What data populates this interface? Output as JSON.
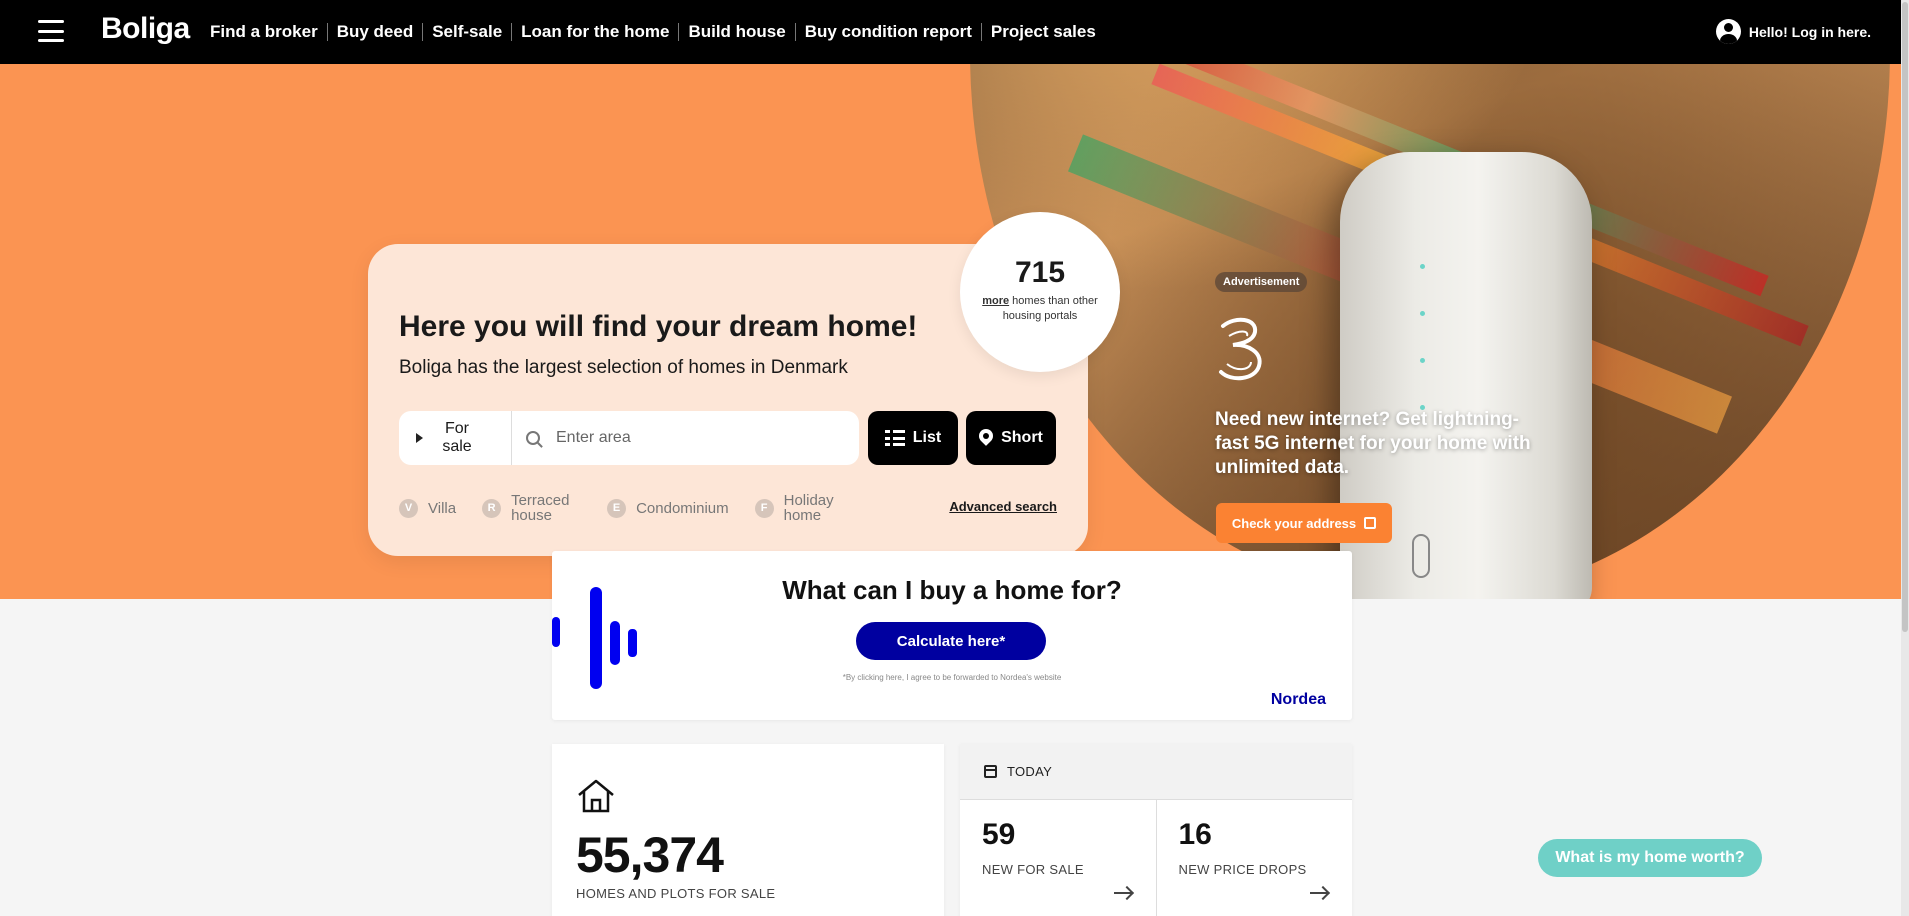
{
  "nav": {
    "logo": "Boliga",
    "links": [
      "Find a broker",
      "Buy deed",
      "Self-sale",
      "Loan for the home",
      "Build house",
      "Buy condition report",
      "Project sales"
    ],
    "login": "Hello! Log in here."
  },
  "search": {
    "headline": "Here you will find your dream home!",
    "subline": "Boliga has the largest selection of homes in Denmark",
    "mode": "For sale",
    "placeholder": "Enter area",
    "list_button": "List",
    "map_button": "Short",
    "property_types": [
      {
        "badge": "V",
        "label": "Villa"
      },
      {
        "badge": "R",
        "label": "Terraced house"
      },
      {
        "badge": "E",
        "label": "Condominium"
      },
      {
        "badge": "F",
        "label": "Holiday home"
      }
    ],
    "advanced": "Advanced search"
  },
  "counter": {
    "number": "715",
    "more": "more",
    "text": "homes than other housing portals"
  },
  "advertisement": {
    "badge": "Advertisement",
    "headline": "Need new internet? Get lightning-fast 5G internet for your home with unlimited data.",
    "cta": "Check your address"
  },
  "nordea": {
    "title": "What can I buy a home for?",
    "button": "Calculate here*",
    "fine_print": "*By clicking here, I agree to be forwarded to Nordea's website",
    "logo": "Nordea"
  },
  "stats": {
    "total": "55,374",
    "total_label": "HOMES AND PLOTS FOR SALE",
    "today_label": "TODAY",
    "new_for_sale": "59",
    "new_for_sale_label": "NEW FOR SALE",
    "price_drops": "16",
    "price_drops_label": "NEW PRICE DROPS"
  },
  "worth_button": "What is my home worth?",
  "colors": {
    "hero_orange": "#fb9452",
    "nordea_blue": "#0000a0",
    "teal": "#6fd0c7",
    "ad_cta_orange": "#fb8232"
  }
}
